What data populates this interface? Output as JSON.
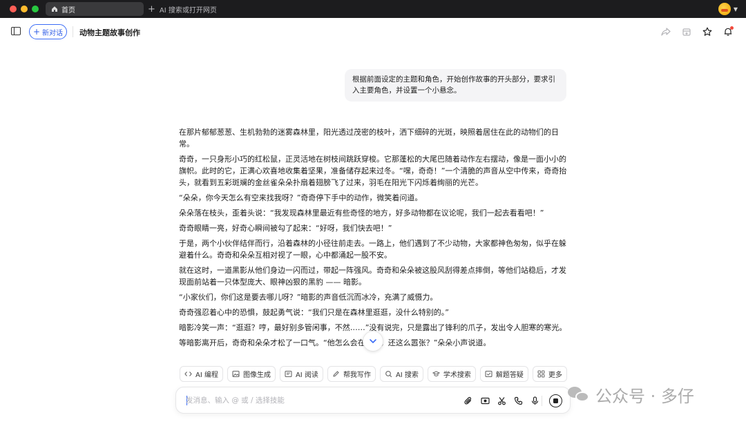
{
  "titlebar": {
    "tabs": [
      {
        "label": "首页",
        "icon": "home-icon",
        "active": true
      }
    ],
    "new_tab_label": "AI 搜索或打开网页"
  },
  "toolbar": {
    "new_chat_label": "新对话",
    "title": "动物主题故事创作",
    "icons": [
      "share-icon",
      "export-icon",
      "star-icon",
      "bell-icon"
    ]
  },
  "conversation": {
    "user_message": "根据前面设定的主题和角色，开始创作故事的开头部分，要求引入主要角色，并设置一个小悬念。",
    "paragraphs": [
      "在那片郁郁葱葱、生机勃勃的迷雾森林里，阳光透过茂密的枝叶，洒下细碎的光斑，映照着居住在此的动物们的日常。",
      "奇奇，一只身形小巧的红松鼠，正灵活地在树枝间跳跃穿梭。它那蓬松的大尾巴随着动作左右摆动，像是一面小小的旗帜。此时的它，正满心欢喜地收集着坚果，准备储存起来过冬。“嘿，奇奇！”一个清脆的声音从空中传来，奇奇抬头，就看到五彩斑斓的金丝雀朵朵扑扇着翅膀飞了过来，羽毛在阳光下闪烁着绚丽的光芒。",
      "“朵朵，你今天怎么有空来找我呀？”奇奇停下手中的动作，微笑着问道。",
      "朵朵落在枝头，歪着头说：“我发现森林里最近有些奇怪的地方，好多动物都在议论呢，我们一起去看看吧！”",
      "奇奇眼睛一亮，好奇心瞬间被勾了起来：“好呀，我们快去吧！”",
      "于是，两个小伙伴结伴而行，沿着森林的小径往前走去。一路上，他们遇到了不少动物，大家都神色匆匆，似乎在躲避着什么。奇奇和朵朵互相对视了一眼，心中都涌起一股不安。",
      "就在这时，一道黑影从他们身边一闪而过，带起一阵强风。奇奇和朵朵被这股风刮得差点摔倒，等他们站稳后，才发现面前站着一只体型庞大、眼神凶狠的黑豹 —— 暗影。",
      "“小家伙们，你们这是要去哪儿呀？”暗影的声音低沉而冰冷，充满了威慑力。",
      "奇奇强忍着心中的恐惧，鼓起勇气说：“我们只是在森林里逛逛，没什么特别的。”",
      "暗影冷笑一声：“逛逛？哼，最好别多管闲事，不然……”没有说完，只是露出了锋利的爪子，发出令人胆寒的寒光。",
      "等暗影离开后，奇奇和朵朵才松了一口气。“他怎么会在这里，还这么嚣张？”朵朵小声说道。"
    ]
  },
  "quick_actions": [
    {
      "label": "AI 编程",
      "icon": "code-icon"
    },
    {
      "label": "图像生成",
      "icon": "image-icon"
    },
    {
      "label": "AI 阅读",
      "icon": "reader-icon"
    },
    {
      "label": "帮我写作",
      "icon": "pen-icon"
    },
    {
      "label": "AI 搜索",
      "icon": "search-icon"
    },
    {
      "label": "学术搜索",
      "icon": "academic-icon"
    },
    {
      "label": "解题答疑",
      "icon": "solve-icon"
    },
    {
      "label": "更多",
      "icon": "grid-icon"
    }
  ],
  "input": {
    "placeholder": "发消息、输入 @ 或 / 选择技能",
    "value": "",
    "icons": [
      "attach-icon",
      "screenshot-icon",
      "scissors-icon",
      "phone-icon",
      "mic-icon",
      "stop-icon"
    ]
  },
  "watermark": {
    "text": "公众号 · 多仔"
  },
  "colors": {
    "accent": "#3b6cf6",
    "titlebar_bg": "#1c1c1e",
    "bubble_bg": "#f4f4f6"
  }
}
